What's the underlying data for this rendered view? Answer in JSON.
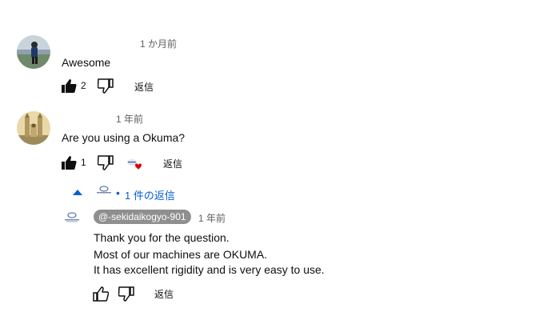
{
  "comments": [
    {
      "timestamp": "1 か月前",
      "text": "Awesome",
      "like_count": "2",
      "reply_label": "返信"
    },
    {
      "timestamp": "1 年前",
      "text": "Are you using a Okuma?",
      "like_count": "1",
      "reply_label": "返信",
      "creator_heart": true,
      "replies_toggle": "1 件の返信"
    }
  ],
  "reply": {
    "author": "@-sekidaikogyo-901",
    "timestamp": "1 年前",
    "lines": [
      "Thank you for the question.",
      "Most of our machines are OKUMA.",
      "It has excellent rigidity and is very easy to use."
    ],
    "reply_label": "返信"
  },
  "colors": {
    "link_blue": "#065fd4",
    "heart_red": "#e00000",
    "chip_gray": "#8f8f8f"
  }
}
